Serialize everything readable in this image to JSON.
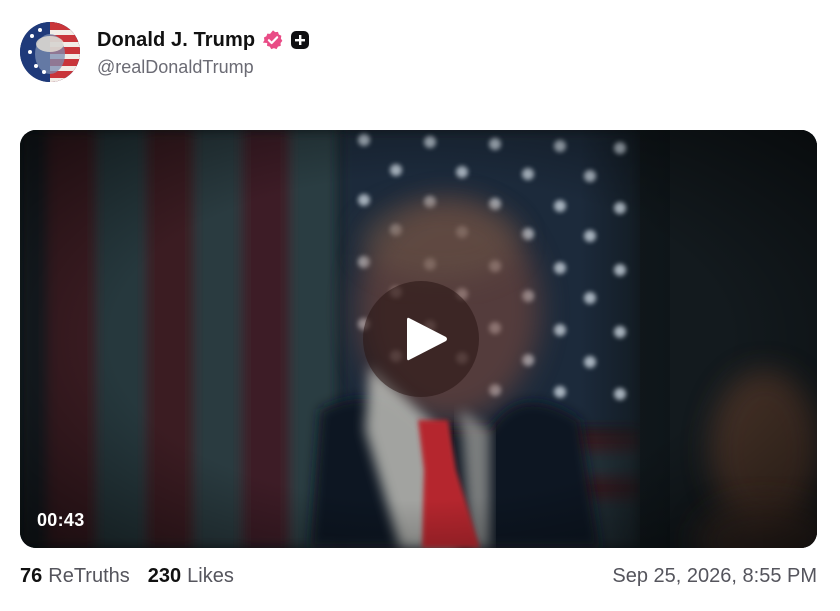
{
  "post": {
    "author": {
      "display_name": "Donald J. Trump",
      "handle": "@realDonaldTrump",
      "avatar_icon": "flag-portrait-avatar",
      "verified_icon": "verified-badge-icon",
      "verified_color": "#e94c86",
      "plus_icon": "plus-badge-icon"
    },
    "media": {
      "type": "video",
      "duration": "00:43",
      "play_icon": "play-icon"
    },
    "stats": {
      "retruths_count": "76",
      "retruths_label": "ReTruths",
      "likes_count": "230",
      "likes_label": "Likes"
    },
    "timestamp": "Sep 25, 2026, 8:55 PM"
  }
}
